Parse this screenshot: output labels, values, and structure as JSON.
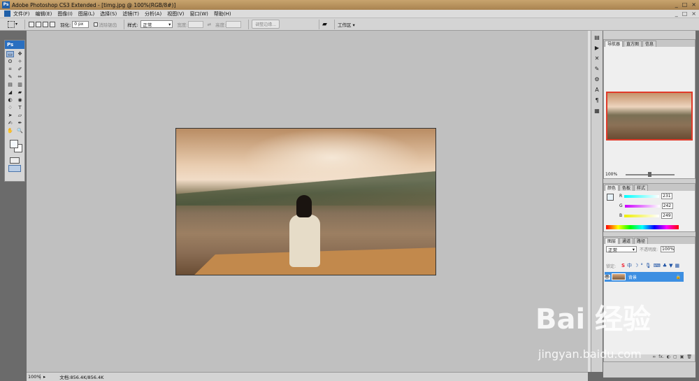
{
  "window": {
    "title": "Adobe Photoshop CS3 Extended - [timg.jpg @ 100%(RGB/8#)]",
    "ps_badge": "Ps",
    "controls": [
      "_",
      "□",
      "×"
    ]
  },
  "menubar": {
    "items": [
      "文件(F)",
      "编辑(E)",
      "图像(I)",
      "图层(L)",
      "选择(S)",
      "滤镜(T)",
      "分析(A)",
      "视图(V)",
      "窗口(W)",
      "帮助(H)"
    ],
    "controls": [
      "_",
      "□",
      "×"
    ]
  },
  "options": {
    "feather_label": "羽化:",
    "feather_value": "0 px",
    "antialias_label": "消除锯齿",
    "style_label": "样式:",
    "style_value": "正常",
    "width_label": "宽度:",
    "height_label": "高度:",
    "refine_edge_label": "调整边缘...",
    "workspace_label": "工作区 ▾"
  },
  "toolbox": {
    "header": "Ps",
    "tools": [
      "▭",
      "✥",
      "ʘ",
      "✧",
      "⌗",
      "✐",
      "✎",
      "✏",
      "▤",
      "▥",
      "◢",
      "▰",
      "◐",
      "◉",
      "♢",
      "T",
      "➤",
      "▱",
      "✍",
      "✒",
      "✋",
      "🔍"
    ]
  },
  "status": {
    "zoom": "100%",
    "doc_info": "文档:856.4K/856.4K"
  },
  "navigator": {
    "tabs": [
      "导航器",
      "直方图",
      "信息"
    ],
    "zoom": "100%"
  },
  "color_panel": {
    "tabs": [
      "颜色",
      "色板",
      "样式"
    ],
    "r_label": "R",
    "r_value": "231",
    "g_label": "G",
    "g_value": "242",
    "b_label": "B",
    "b_value": "249"
  },
  "layers_panel": {
    "tabs": [
      "图层",
      "通道",
      "路径"
    ],
    "blend_mode": "正常",
    "opacity_label": "不透明度:",
    "opacity_value": "100%",
    "lock_label": "锁定:",
    "layer_name": "背景",
    "footer_icons": [
      "∞",
      "fx.",
      "◐",
      "▢",
      "▣",
      "🗑"
    ]
  },
  "watermark": {
    "brand": "Bai 经验",
    "url": "jingyan.baidu.com"
  },
  "colors": {
    "title_bar": "#b58e5b",
    "selected_layer": "#3d8fe2",
    "nav_frame": "#e03a2a"
  }
}
